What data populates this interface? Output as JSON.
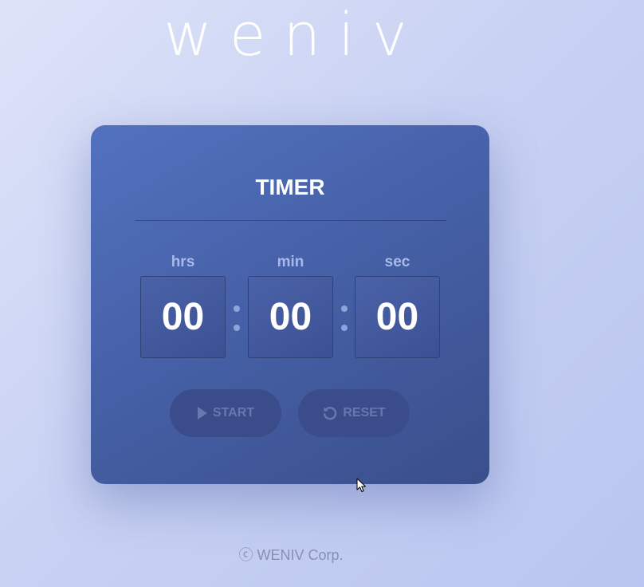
{
  "logo": {
    "text": "weniv"
  },
  "timer": {
    "title": "TIMER",
    "units": [
      {
        "label": "hrs",
        "value": "00"
      },
      {
        "label": "min",
        "value": "00"
      },
      {
        "label": "sec",
        "value": "00"
      }
    ],
    "buttons": {
      "start_label": "START",
      "reset_label": "RESET",
      "start_icon": "play-icon",
      "reset_icon": "reset-icon"
    }
  },
  "footer": {
    "text": "ⓒ WENIV Corp."
  },
  "colors": {
    "background": "#c9d2f3",
    "card": "#4661a8",
    "button": "#3a4d8a",
    "button_text": "#6678b0",
    "label": "#a8b9ea"
  }
}
